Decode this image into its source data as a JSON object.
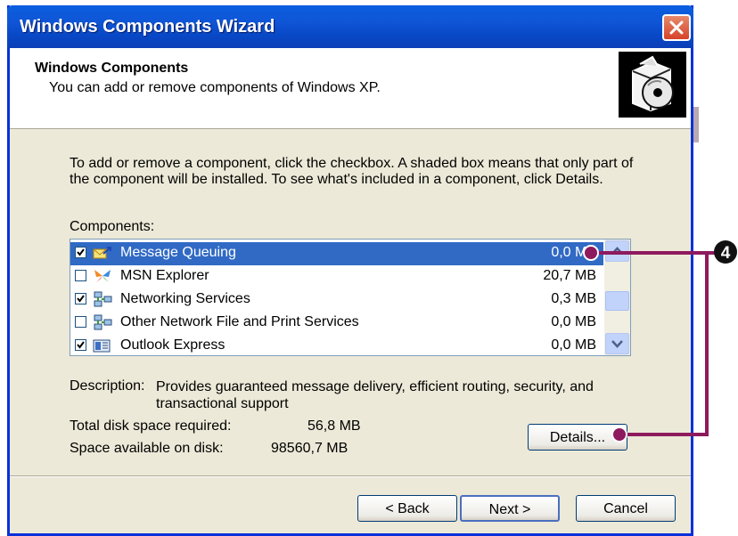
{
  "window": {
    "title": "Windows Components Wizard"
  },
  "header": {
    "title": "Windows Components",
    "subtitle": "You can add or remove components of Windows XP."
  },
  "intro": "To add or remove a component, click the checkbox.  A shaded box means that only part of the component will be installed.  To see what's included in a component, click Details.",
  "components": {
    "label": "Components:",
    "items": [
      {
        "name": "Message Queuing",
        "size": "0,0 MB",
        "checked": true,
        "selected": true,
        "icon": "message-queuing-icon"
      },
      {
        "name": "MSN Explorer",
        "size": "20,7 MB",
        "checked": false,
        "selected": false,
        "icon": "msn-butterfly-icon"
      },
      {
        "name": "Networking Services",
        "size": "0,3 MB",
        "checked": true,
        "selected": false,
        "icon": "network-computers-icon"
      },
      {
        "name": "Other Network File and Print Services",
        "size": "0,0 MB",
        "checked": false,
        "selected": false,
        "icon": "network-computers-icon"
      },
      {
        "name": "Outlook Express",
        "size": "0,0 MB",
        "checked": true,
        "selected": false,
        "icon": "outlook-express-icon"
      }
    ]
  },
  "description": {
    "label": "Description:",
    "text": "Provides guaranteed message delivery, efficient routing, security, and transactional support"
  },
  "disk": {
    "required_label": "Total disk space required:",
    "required_value": "56,8 MB",
    "available_label": "Space available on disk:",
    "available_value": "98560,7 MB"
  },
  "buttons": {
    "details": "Details...",
    "back": "< Back",
    "next": "Next >",
    "cancel": "Cancel"
  },
  "callout": {
    "number": "4",
    "color": "#8e1a5e"
  }
}
